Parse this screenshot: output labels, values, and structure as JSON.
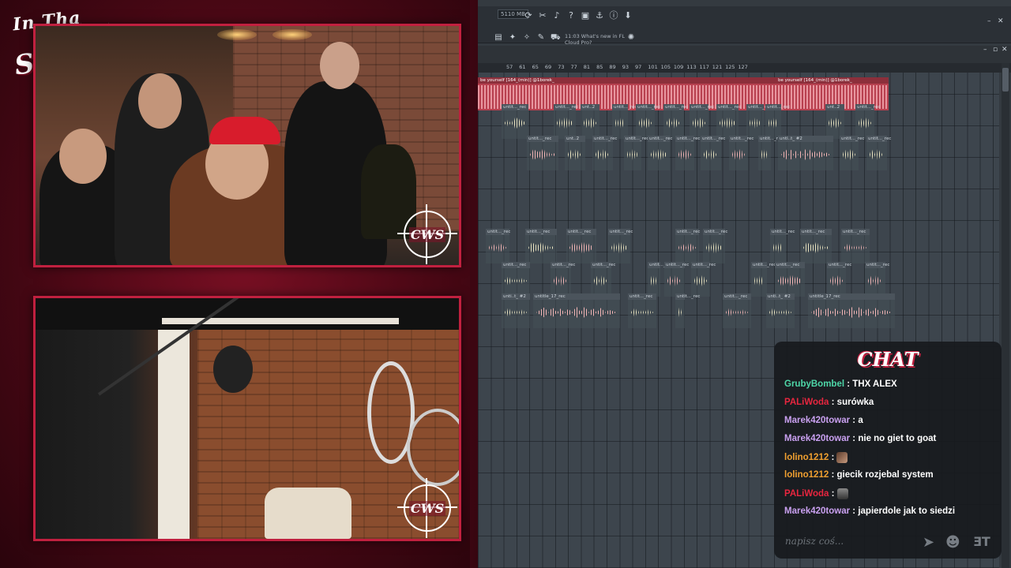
{
  "overlay": {
    "logo_line1": "In Tha",
    "logo_line2": "Studio!",
    "cam_logo": "CWS",
    "accent": "#c1203f"
  },
  "fl": {
    "memory": "5110 MB",
    "whats_new": "11:03  What's new in FL Cloud Pro?",
    "ruler_ticks": [
      "57",
      "61",
      "65",
      "69",
      "73",
      "77",
      "81",
      "85",
      "89",
      "93",
      "97",
      "101",
      "105",
      "109",
      "113",
      "117",
      "121",
      "125",
      "127"
    ],
    "track_labels": {
      "big": "be yourself [164_(min)] @1borek_",
      "untitled": "untit..._rec",
      "untitled_short": "unt..2",
      "untitled_b2": "unti..t_ #2",
      "untitled_17": "untitle_17_rec"
    },
    "icons": [
      "refresh-icon",
      "scissors-icon",
      "mic-icon",
      "help-icon",
      "save-icon",
      "plugin-icon",
      "info-icon",
      "download-icon"
    ]
  },
  "chat": {
    "title": "CHAT",
    "messages": [
      {
        "user": "GrubyBombel",
        "color": "#4ed7a8",
        "text": "THX ALEX"
      },
      {
        "user": "PALiWoda",
        "color": "#e8263f",
        "text": "surówka"
      },
      {
        "user": "Marek420towar",
        "color": "#c9a0f0",
        "text": "a"
      },
      {
        "user": "Marek420towar",
        "color": "#c9a0f0",
        "text": "nie no giet to goat"
      },
      {
        "user": "lolino1212",
        "color": "#f0a030",
        "text": "",
        "emote": true
      },
      {
        "user": "lolino1212",
        "color": "#f0a030",
        "text": "giecik rozjebal system"
      },
      {
        "user": "PALiWoda",
        "color": "#e8263f",
        "text": "",
        "emote": true
      },
      {
        "user": "Marek420towar",
        "color": "#c9a0f0",
        "text": "japierdole jak to siedzi"
      }
    ],
    "input_placeholder": "napisz coś...",
    "icons": [
      "send-icon",
      "emoji-icon",
      "emote-picker-icon"
    ]
  }
}
